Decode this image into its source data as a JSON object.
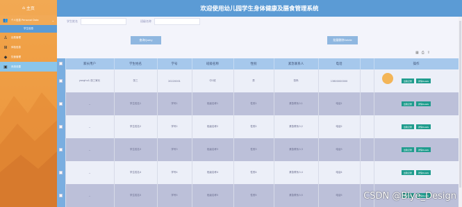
{
  "sidebar": {
    "home_label": "主页",
    "items": [
      {
        "label": "个人信息 Personal Data",
        "icon": "user-icon",
        "group": true
      },
      {
        "label": "学生信息",
        "sub": true,
        "active": true
      },
      {
        "label": "出勤管理",
        "icon": "person-icon"
      },
      {
        "label": "体检信息",
        "icon": "grid-icon"
      },
      {
        "label": "饮食管理",
        "icon": "tag-icon"
      },
      {
        "label": "系统设置",
        "icon": "monitor-icon",
        "highlight": true
      }
    ]
  },
  "header": {
    "title": "欢迎使用幼儿园学生身体健康及膳食管理系统"
  },
  "search": {
    "student_name_label": "学生姓名",
    "class_name_label": "班级名称",
    "student_name_value": "",
    "class_name_value": "",
    "search_button": "查询Query",
    "delete_button": "批量删除Delete"
  },
  "toolbar_icons": [
    "grid-icon",
    "print-icon",
    "export-icon"
  ],
  "table": {
    "headers": [
      "家长用户",
      "学生姓名",
      "学号",
      "班级名称",
      "性别",
      "紧急联系人",
      "电话",
      "",
      "操作"
    ],
    "rows": [
      {
        "cells": [
          "yonghu1-张三家长",
          "张三",
          "20220001",
          "中1班",
          "男",
          "张妈",
          "13800000000",
          ""
        ]
      },
      {
        "cells": [
          "--",
          "学生姓名1",
          "学号1",
          "班级名称1",
          "性别1",
          "紧急联系人1",
          "电话1",
          ""
        ]
      },
      {
        "cells": [
          "--",
          "学生姓名2",
          "学号2",
          "班级名称2",
          "性别2",
          "紧急联系人2",
          "电话2",
          ""
        ]
      },
      {
        "cells": [
          "--",
          "学生姓名3",
          "学号3",
          "班级名称3",
          "性别3",
          "紧急联系人3",
          "电话3",
          ""
        ]
      },
      {
        "cells": [
          "--",
          "学生姓名4",
          "学号4",
          "班级名称4",
          "性别4",
          "紧急联系人4",
          "电话4",
          ""
        ]
      },
      {
        "cells": [
          "--",
          "学生姓名5",
          "学号5",
          "班级名称5",
          "性别5",
          "紧急联系人5",
          "电话5",
          ""
        ]
      }
    ],
    "edit_label": "出勤记录",
    "detail_label": "详情Details"
  },
  "watermark": "CSDN @Blye_Design"
}
